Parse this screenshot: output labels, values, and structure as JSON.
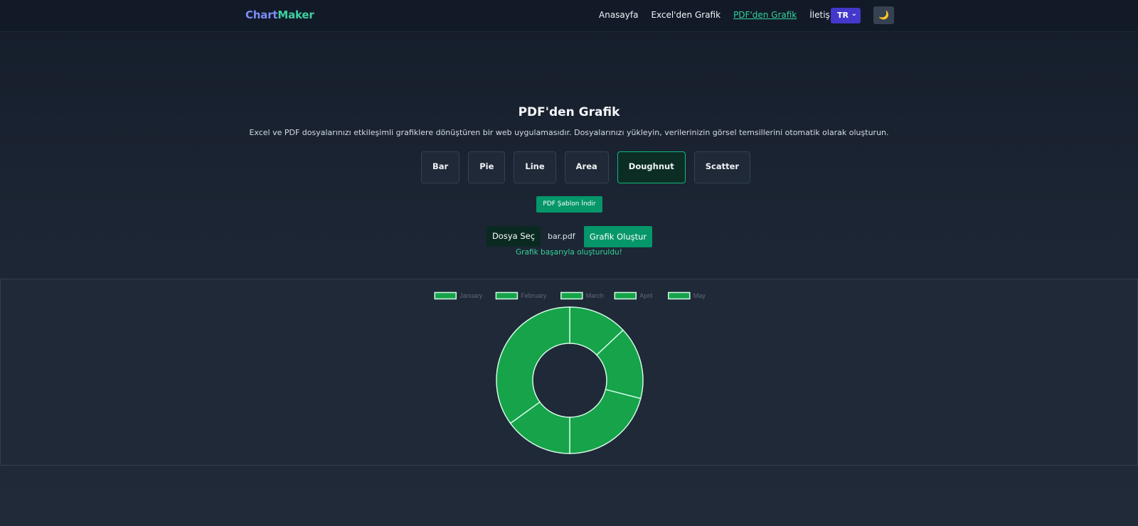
{
  "nav": {
    "brand_part1": "Chart",
    "brand_part2": "Maker",
    "links": [
      "Anasayfa",
      "Excel'den Grafik",
      "PDF'den Grafik",
      "İletişim"
    ],
    "active_link": "PDF'den Grafik",
    "language": "TR",
    "theme_icon": "moon-icon",
    "theme_glyph": "🌙"
  },
  "page": {
    "title": "PDF'den Grafik",
    "description": "Excel ve PDF dosyalarınızı etkileşimli grafiklere dönüştüren bir web uygulamasıdır. Dosyalarınızı yükleyin, verilerinizin görsel temsillerini otomatik olarak oluşturun."
  },
  "chart_types": [
    "Bar",
    "Pie",
    "Line",
    "Area",
    "Doughnut",
    "Scatter"
  ],
  "selected_chart_type": "Doughnut",
  "actions": {
    "template_button": "PDF Şablon İndir",
    "file_select_button": "Dosya Seç",
    "file_name": "bar.pdf",
    "create_button": "Grafik Oluştur",
    "success_message": "Grafik başarıyla oluşturuldu!"
  },
  "colors": {
    "accent": "#10b981",
    "slice_fill": "#16a34a",
    "slice_border": "#d1fae5"
  },
  "chart_data": {
    "type": "doughnut",
    "categories": [
      "January",
      "February",
      "March",
      "April",
      "May"
    ],
    "values": [
      13,
      16,
      21,
      15,
      35
    ],
    "legend_position": "top"
  }
}
